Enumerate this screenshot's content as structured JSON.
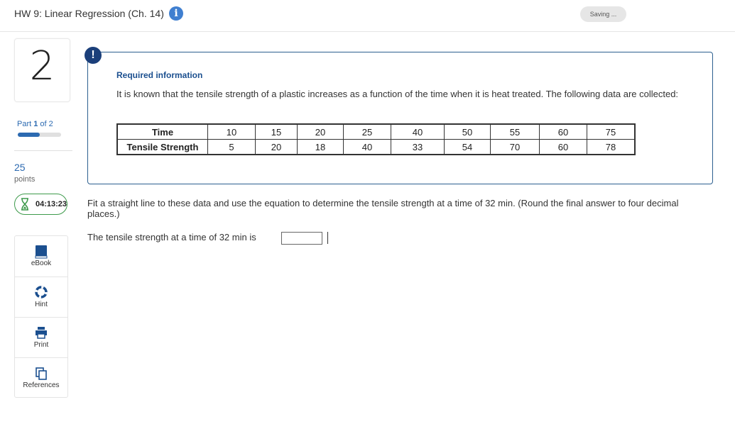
{
  "header": {
    "title": "HW 9: Linear Regression (Ch. 14)",
    "info_icon": "info-icon",
    "saving_label": "Saving ..."
  },
  "sidebar": {
    "question_number": "2",
    "part_prefix": "Part ",
    "part_current": "1",
    "part_suffix": " of 2",
    "part_progress": 0.5,
    "points_value": "25",
    "points_label": "points",
    "timer": "04:13:23",
    "tools": [
      {
        "label": "eBook",
        "icon": "book-icon"
      },
      {
        "label": "Hint",
        "icon": "lifebuoy-icon"
      },
      {
        "label": "Print",
        "icon": "printer-icon"
      },
      {
        "label": "References",
        "icon": "documents-icon"
      }
    ]
  },
  "required": {
    "badge": "!",
    "title": "Required information",
    "text": "It is known that the tensile strength of a plastic increases as a function of the time when it is heat treated. The following data are collected:",
    "table": {
      "row_labels": [
        "Time",
        "Tensile Strength"
      ],
      "time": [
        "10",
        "15",
        "20",
        "25",
        "40",
        "50",
        "55",
        "60",
        "75"
      ],
      "strength": [
        "5",
        "20",
        "18",
        "40",
        "33",
        "54",
        "70",
        "60",
        "78"
      ]
    }
  },
  "question": {
    "text": "Fit a straight line to these data and use the equation to determine the tensile strength at a time of 32 min. (Round the final answer to four decimal places.)",
    "answer_prompt": "The tensile strength at a time of 32 min is",
    "answer_value": ""
  },
  "colors": {
    "accent_blue": "#2c6ab1",
    "dark_navy": "#1b3f7a",
    "timer_green": "#3d9a4b"
  }
}
